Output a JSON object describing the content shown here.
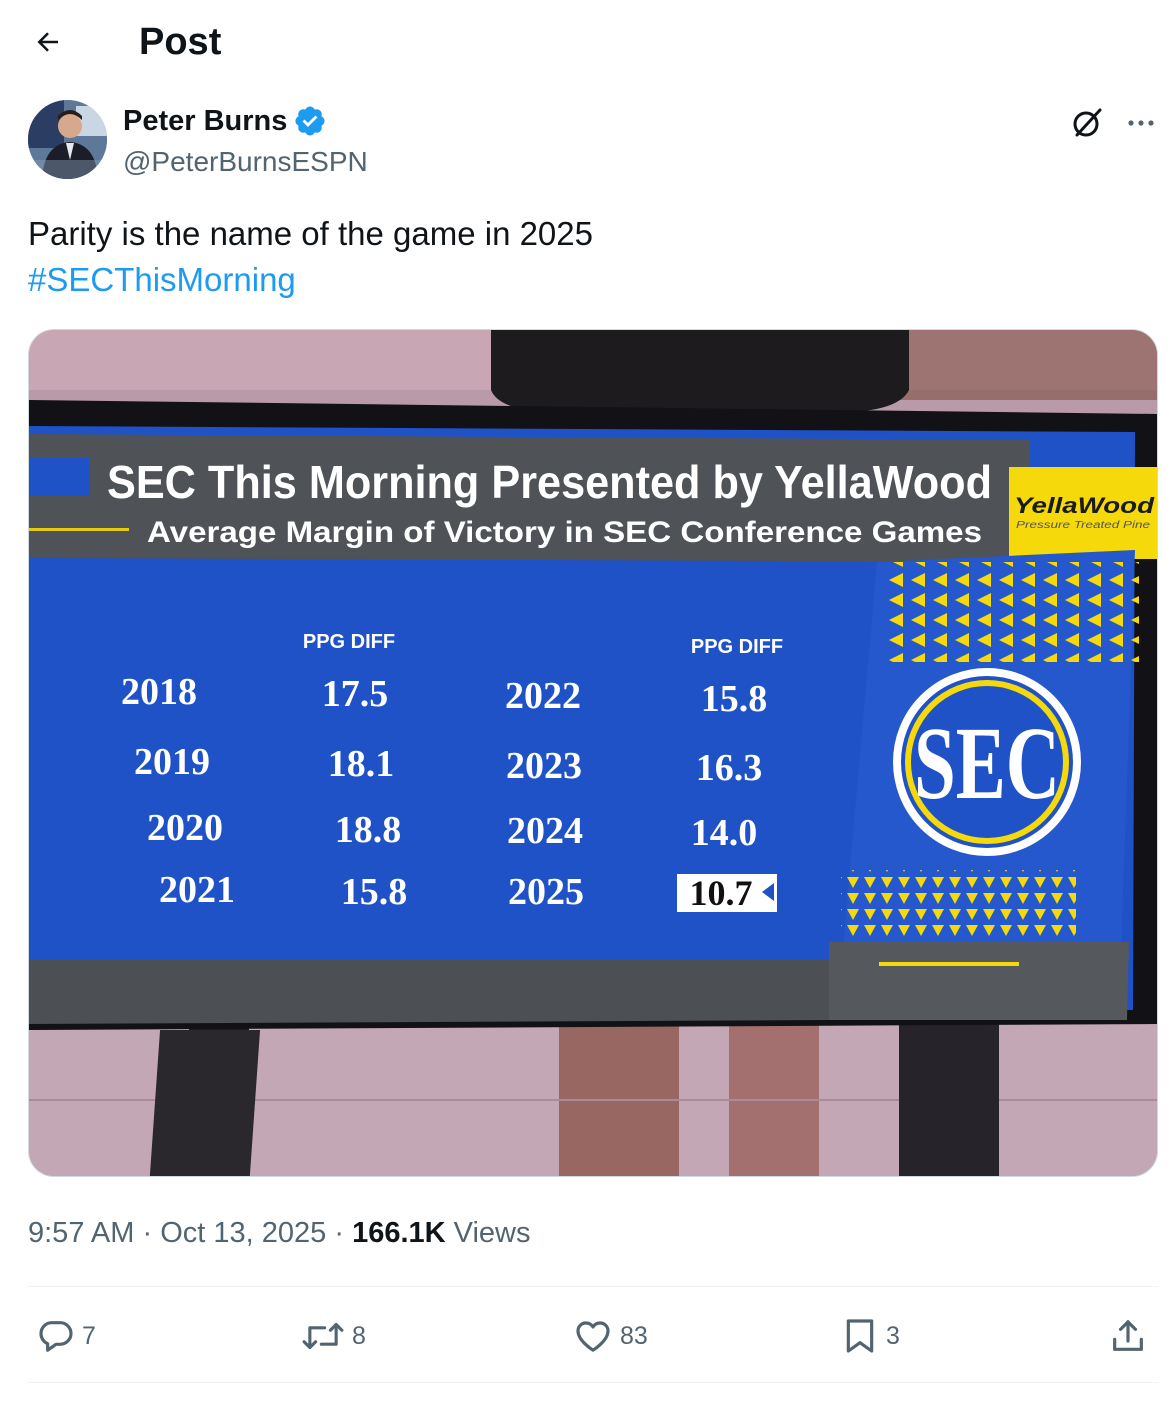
{
  "header": {
    "title": "Post"
  },
  "author": {
    "name": "Peter Burns",
    "handle": "@PeterBurnsESPN",
    "verified": true
  },
  "post": {
    "text": "Parity is the name of the game in 2025",
    "hashtag": "#SECThisMorning"
  },
  "graphic": {
    "title": "SEC This Morning Presented by YellaWood",
    "subtitle": "Average Margin of Victory in SEC Conference Games",
    "sponsor_logo_text": "YellaWood",
    "sponsor_logo_tagline": "Pressure Treated Pine",
    "column_header": "PPG DIFF",
    "logo_text": "SEC",
    "left_rows": [
      {
        "year": "2018",
        "diff": "17.5"
      },
      {
        "year": "2019",
        "diff": "18.1"
      },
      {
        "year": "2020",
        "diff": "18.8"
      },
      {
        "year": "2021",
        "diff": "15.8"
      }
    ],
    "right_rows": [
      {
        "year": "2022",
        "diff": "15.8"
      },
      {
        "year": "2023",
        "diff": "16.3"
      },
      {
        "year": "2024",
        "diff": "14.0"
      },
      {
        "year": "2025",
        "diff": "10.7"
      }
    ]
  },
  "meta": {
    "time": "9:57 AM",
    "sep": "·",
    "date": "Oct 13, 2025",
    "views_count": "166.1K",
    "views_label": "Views"
  },
  "actions": {
    "replies": "7",
    "reposts": "8",
    "likes": "83",
    "bookmarks": "3"
  },
  "colors": {
    "accent": "#1d9bf0",
    "text": "#0f1419",
    "secondary": "#536471",
    "graphic_blue": "#1f52c6",
    "graphic_yellow": "#f5d90a"
  }
}
